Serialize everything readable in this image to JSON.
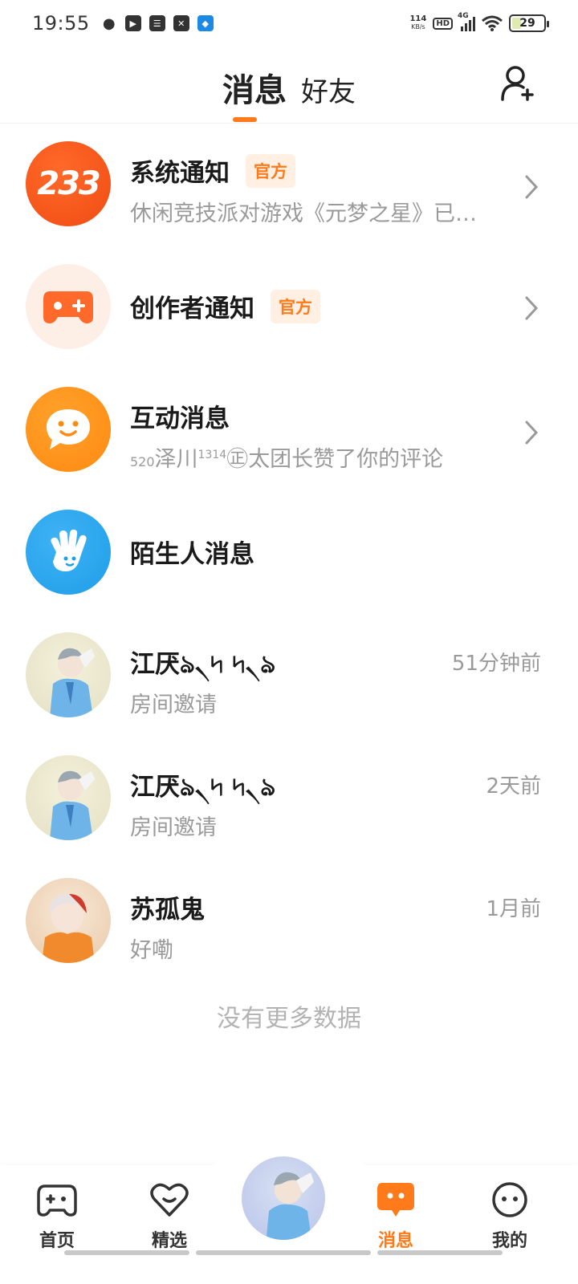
{
  "status_bar": {
    "time": "19:55",
    "net_speed_value": "114",
    "net_speed_unit": "KB/s",
    "hd": "HD",
    "network": "4G",
    "battery": "29",
    "battery_level": 0.29
  },
  "header": {
    "tabs": [
      {
        "label": "消息",
        "active": true
      },
      {
        "label": "好友",
        "active": false
      }
    ],
    "accent_color": "#ff7a1a"
  },
  "messages": [
    {
      "name": "系统通知",
      "badge": "官方",
      "preview": "休闲竞技派对游戏《元梦之星》已…",
      "avatar_text": "233",
      "has_arrow": true,
      "icon": "logo-233-icon"
    },
    {
      "name": "创作者通知",
      "badge": "官方",
      "preview": "",
      "has_arrow": true,
      "icon": "gamepad-icon"
    },
    {
      "name": "互动消息",
      "preview_prefix": "520",
      "preview_main": "泽川",
      "preview_sup": "1314",
      "preview_mark": "㊣",
      "preview_rest": "太团长赞了你的评论",
      "has_arrow": true,
      "icon": "chat-bubble-icon"
    },
    {
      "name": "陌生人消息",
      "has_arrow": false,
      "icon": "hand-wave-icon"
    },
    {
      "name": "江厌ঌ৲৸ ৸৲ঌ",
      "preview": "房间邀请",
      "time": "51分钟前",
      "icon": "user-avatar"
    },
    {
      "name": "江厌ঌ৲৸ ৸৲ঌ",
      "preview": "房间邀请",
      "time": "2天前",
      "icon": "user-avatar"
    },
    {
      "name": "苏孤鬼",
      "preview": "好嘞",
      "time": "1月前",
      "icon": "user-avatar"
    }
  ],
  "footer_text": "没有更多数据",
  "bottom_nav": [
    {
      "label": "首页",
      "icon": "gamepad-icon",
      "active": false
    },
    {
      "label": "精选",
      "icon": "heart-icon",
      "active": false
    },
    {
      "label": "消息",
      "icon": "message-icon",
      "active": true
    },
    {
      "label": "我的",
      "icon": "smiley-icon",
      "active": false
    }
  ]
}
